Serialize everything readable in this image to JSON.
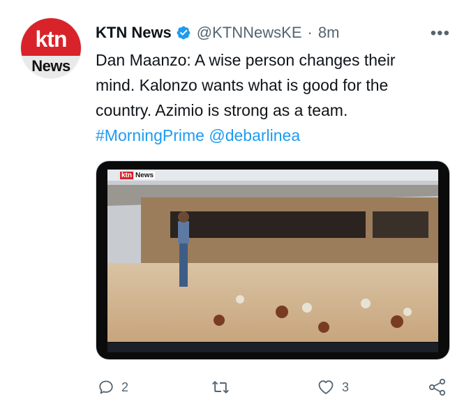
{
  "avatar": {
    "top": "ktn",
    "bottom": "News"
  },
  "tweet": {
    "name": "KTN News",
    "handle": "@KTNNewsKE",
    "separator": "·",
    "time": "8m",
    "more": "•••",
    "text_line1": "Dan Maanzo: A wise person changes their",
    "text_line2": "mind. Kalonzo wants what is good for the",
    "text_line3": "country. Azimio is strong as a team.",
    "hashtag": "#MorningPrime",
    "mention": "@debarlinea"
  },
  "media": {
    "logo_red": "ktn",
    "logo_white": "News"
  },
  "actions": {
    "reply_count": "2",
    "like_count": "3"
  },
  "colors": {
    "link": "#1d9bf0",
    "brand_red": "#d8232a",
    "muted": "#536471"
  },
  "icons": {
    "verified": "verified-badge-icon",
    "reply": "reply-icon",
    "retweet": "retweet-icon",
    "like": "heart-icon",
    "share": "share-icon"
  }
}
